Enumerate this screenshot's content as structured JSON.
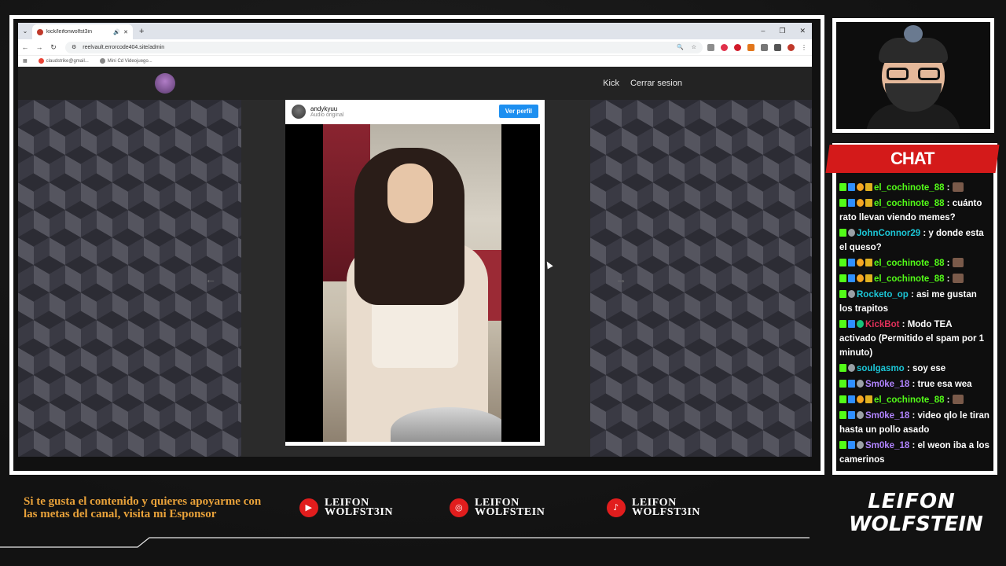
{
  "browser": {
    "tab_title": "kick/leifonwolfst3in",
    "url": "reelvault.errorcode404.site/admin",
    "bookmarks": [
      {
        "label": "claudstrike@gmail..."
      },
      {
        "label": "Mini Cd Videojuego..."
      }
    ]
  },
  "site": {
    "nav": [
      "Kick",
      "Cerrar sesion"
    ]
  },
  "reel": {
    "username": "andykyuu",
    "audio": "Audio original",
    "profile_button": "Ver perfil"
  },
  "chat": {
    "title": "CHAT",
    "messages": [
      {
        "user": "el_cochinote_88",
        "color": "#53fc18",
        "text": "",
        "emote": true,
        "badges": [
          "k",
          "mod",
          "sub",
          "gift"
        ]
      },
      {
        "user": "el_cochinote_88",
        "color": "#53fc18",
        "text": "cuánto rato llevan viendo memes?",
        "emote": false,
        "badges": [
          "k",
          "mod",
          "sub",
          "gift"
        ]
      },
      {
        "user": "JohnConnor29",
        "color": "#1cc6d6",
        "text": "y donde esta el queso?",
        "emote": false,
        "badges": [
          "k",
          "g"
        ]
      },
      {
        "user": "el_cochinote_88",
        "color": "#53fc18",
        "text": "",
        "emote": true,
        "badges": [
          "k",
          "mod",
          "sub",
          "gift"
        ]
      },
      {
        "user": "el_cochinote_88",
        "color": "#53fc18",
        "text": "",
        "emote": true,
        "badges": [
          "k",
          "mod",
          "sub",
          "gift"
        ]
      },
      {
        "user": "Rocketo_op",
        "color": "#1cc6d6",
        "text": "asi me gustan los trapitos",
        "emote": false,
        "badges": [
          "k",
          "g"
        ]
      },
      {
        "user": "KickBot",
        "color": "#e0305a",
        "text": "Modo TEA activado (Permitido el spam por 1 minuto)",
        "emote": false,
        "badges": [
          "k",
          "mod",
          "v"
        ]
      },
      {
        "user": "soulgasmo",
        "color": "#1cc6d6",
        "text": "soy ese",
        "emote": false,
        "badges": [
          "k",
          "g"
        ]
      },
      {
        "user": "Sm0ke_18",
        "color": "#b184ff",
        "text": "true esa wea",
        "emote": false,
        "badges": [
          "k",
          "mod",
          "g"
        ]
      },
      {
        "user": "el_cochinote_88",
        "color": "#53fc18",
        "text": "",
        "emote": true,
        "badges": [
          "k",
          "mod",
          "sub",
          "gift"
        ]
      },
      {
        "user": "Sm0ke_18",
        "color": "#b184ff",
        "text": "video qlo le tiran hasta un pollo asado",
        "emote": false,
        "badges": [
          "k",
          "mod",
          "g"
        ]
      },
      {
        "user": "Sm0ke_18",
        "color": "#b184ff",
        "text": "el weon iba a los camerinos",
        "emote": false,
        "badges": [
          "k",
          "mod",
          "g"
        ]
      }
    ]
  },
  "bottom": {
    "sponsor_text": "Si te gusta el contenido y quieres apoyarme con las metas del canal, visita mi Esponsor",
    "socials": [
      {
        "icon": "youtube-icon",
        "line1": "LEIFON",
        "line2": "WOLFST3IN"
      },
      {
        "icon": "instagram-icon",
        "line1": "LEIFON",
        "line2": "WOLFSTEIN"
      },
      {
        "icon": "tiktok-icon",
        "line1": "LEIFON",
        "line2": "WOLFST3IN"
      }
    ],
    "brand_line1": "LEIFON",
    "brand_line2": "WOLFSTEIN"
  },
  "colors": {
    "accent_red": "#d41a1a",
    "sponsor_orange": "#e9a23a",
    "kick_green": "#53fc18",
    "button_blue": "#1d8ff0"
  }
}
